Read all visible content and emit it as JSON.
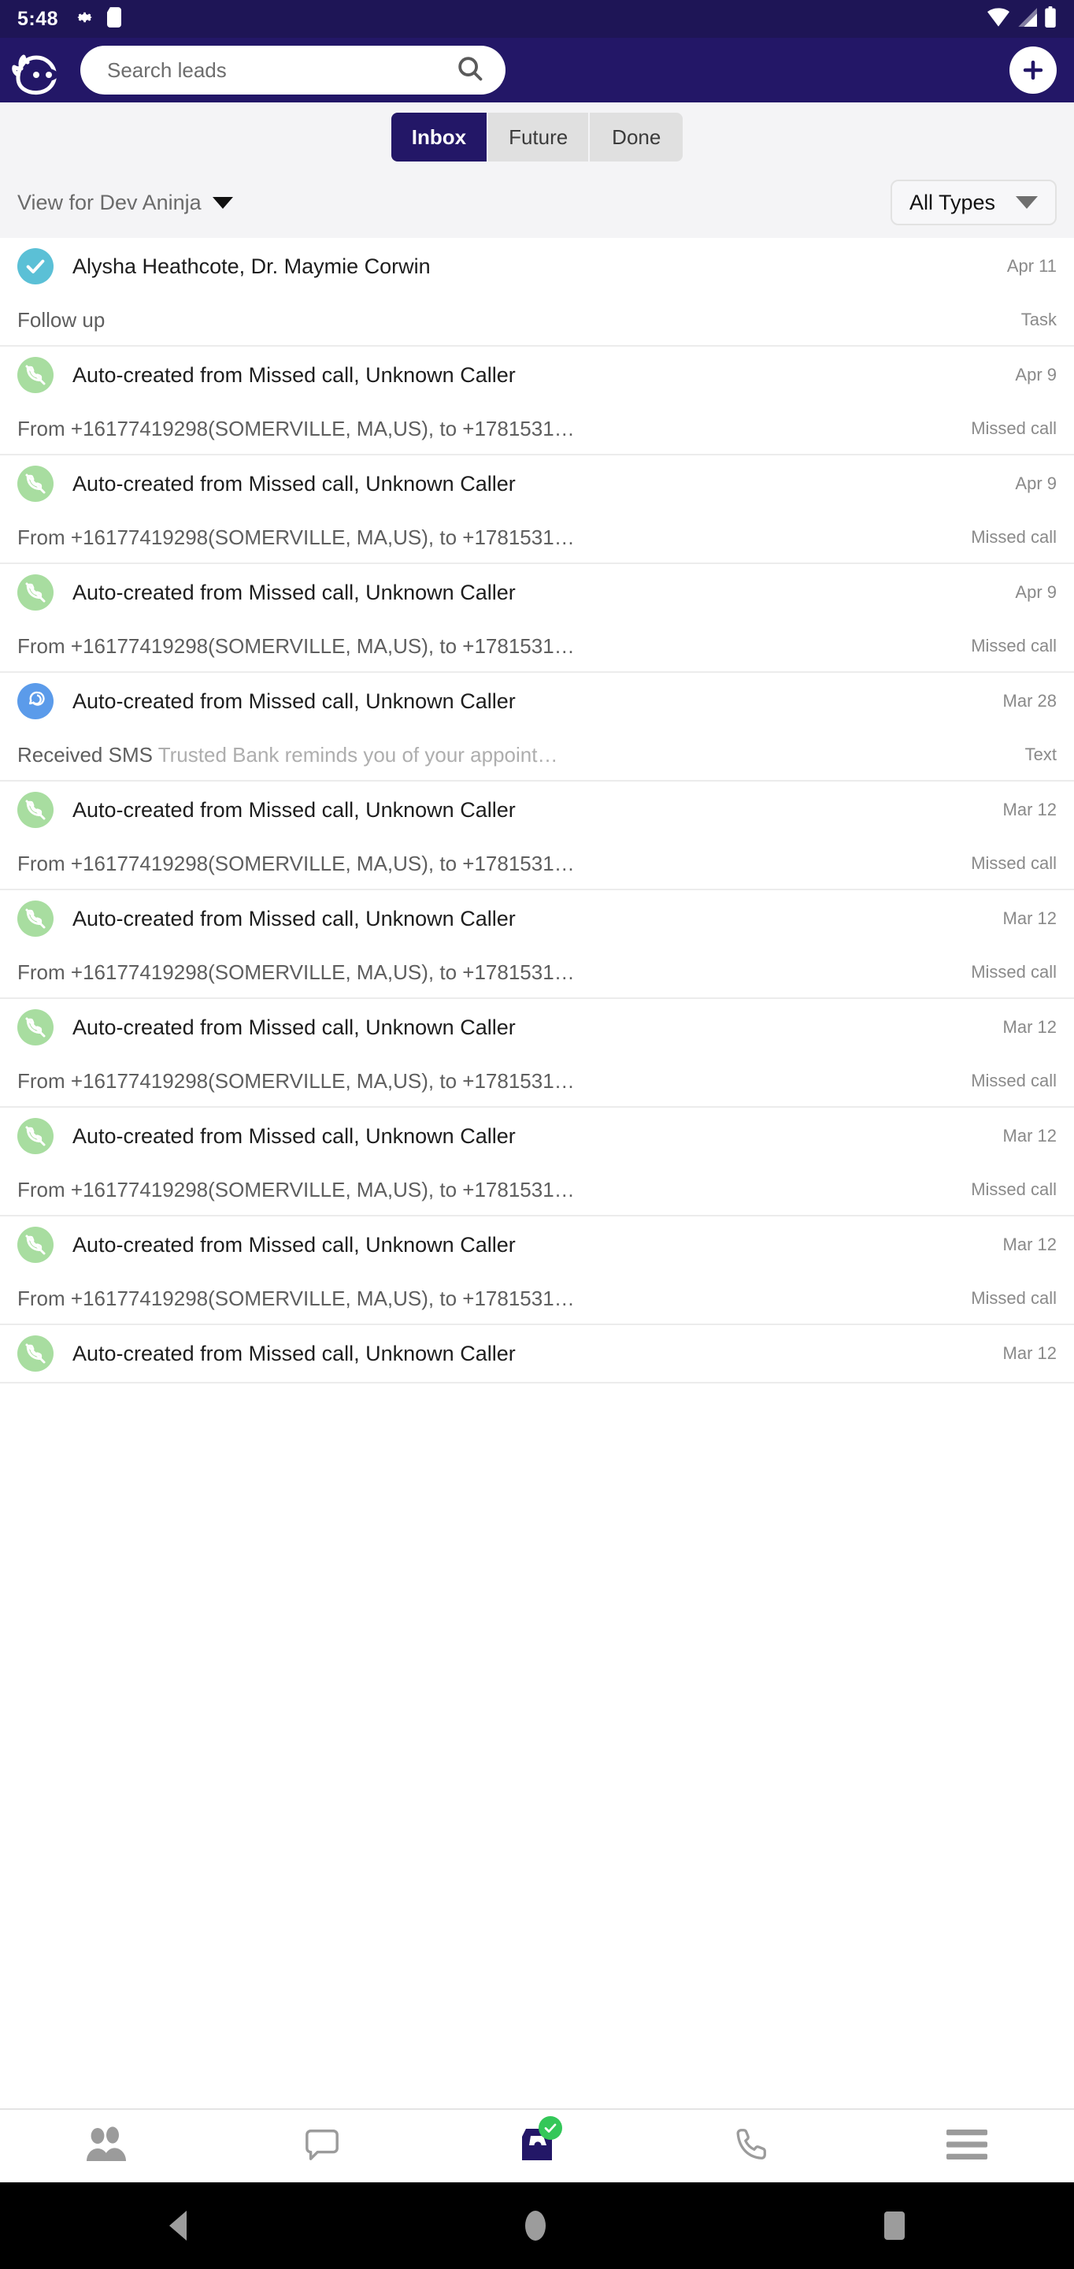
{
  "status_bar": {
    "time": "5:48",
    "left_icons": [
      "gear-icon",
      "sd-card-icon"
    ],
    "right_icons": [
      "wifi-icon",
      "signal-icon",
      "battery-icon"
    ]
  },
  "app_bar": {
    "logo": "ninja-logo",
    "search_placeholder": "Search leads",
    "search_value": "",
    "search_icon": "search-icon",
    "add_button": "+"
  },
  "tabs": [
    {
      "label": "Inbox",
      "active": true
    },
    {
      "label": "Future",
      "active": false
    },
    {
      "label": "Done",
      "active": false
    }
  ],
  "filter_bar": {
    "view_for": "View for Dev Aninja",
    "types_selected": "All Types"
  },
  "colors": {
    "header": "#231767",
    "status_bar": "#1e1556",
    "accent": "#231767",
    "task_avatar": "#5bc0d6",
    "call_avatar": "#a8dda0",
    "text_avatar": "#5b9bea",
    "badge_green": "#34c759",
    "page_bg": "#f4f4f6"
  },
  "list": [
    {
      "icon": "check-circle-icon",
      "icon_kind": "task",
      "title": "Alysha Heathcote, Dr. Maymie Corwin",
      "date": "Apr 11",
      "subtitle_dark": "Follow up",
      "subtitle_light": "",
      "badge": "Task"
    },
    {
      "icon": "missed-call-icon",
      "icon_kind": "call",
      "title": "Auto-created from Missed call, Unknown Caller",
      "date": "Apr 9",
      "subtitle_dark": "From +16177419298(SOMERVILLE, MA,US), to +1781531…",
      "subtitle_light": "",
      "badge": "Missed call"
    },
    {
      "icon": "missed-call-icon",
      "icon_kind": "call",
      "title": "Auto-created from Missed call, Unknown Caller",
      "date": "Apr 9",
      "subtitle_dark": "From +16177419298(SOMERVILLE, MA,US), to +1781531…",
      "subtitle_light": "",
      "badge": "Missed call"
    },
    {
      "icon": "missed-call-icon",
      "icon_kind": "call",
      "title": "Auto-created from Missed call, Unknown Caller",
      "date": "Apr 9",
      "subtitle_dark": "From +16177419298(SOMERVILLE, MA,US), to +1781531…",
      "subtitle_light": "",
      "badge": "Missed call"
    },
    {
      "icon": "chat-bubbles-icon",
      "icon_kind": "text",
      "title": "Auto-created from Missed call, Unknown Caller",
      "date": "Mar 28",
      "subtitle_dark": "Received SMS",
      "subtitle_light": "Trusted Bank reminds you of your appoint…",
      "badge": "Text"
    },
    {
      "icon": "missed-call-icon",
      "icon_kind": "call",
      "title": "Auto-created from Missed call, Unknown Caller",
      "date": "Mar 12",
      "subtitle_dark": "From +16177419298(SOMERVILLE, MA,US), to +1781531…",
      "subtitle_light": "",
      "badge": "Missed call"
    },
    {
      "icon": "missed-call-icon",
      "icon_kind": "call",
      "title": "Auto-created from Missed call, Unknown Caller",
      "date": "Mar 12",
      "subtitle_dark": "From +16177419298(SOMERVILLE, MA,US), to +1781531…",
      "subtitle_light": "",
      "badge": "Missed call"
    },
    {
      "icon": "missed-call-icon",
      "icon_kind": "call",
      "title": "Auto-created from Missed call, Unknown Caller",
      "date": "Mar 12",
      "subtitle_dark": "From +16177419298(SOMERVILLE, MA,US), to +1781531…",
      "subtitle_light": "",
      "badge": "Missed call"
    },
    {
      "icon": "missed-call-icon",
      "icon_kind": "call",
      "title": "Auto-created from Missed call, Unknown Caller",
      "date": "Mar 12",
      "subtitle_dark": "From +16177419298(SOMERVILLE, MA,US), to +1781531…",
      "subtitle_light": "",
      "badge": "Missed call"
    },
    {
      "icon": "missed-call-icon",
      "icon_kind": "call",
      "title": "Auto-created from Missed call, Unknown Caller",
      "date": "Mar 12",
      "subtitle_dark": "From +16177419298(SOMERVILLE, MA,US), to +1781531…",
      "subtitle_light": "",
      "badge": "Missed call"
    },
    {
      "icon": "missed-call-icon",
      "icon_kind": "call",
      "title": "Auto-created from Missed call, Unknown Caller",
      "date": "Mar 12",
      "subtitle_dark": "",
      "subtitle_light": "",
      "badge": ""
    }
  ],
  "bottom_nav": [
    {
      "icon": "contacts-icon",
      "active": false
    },
    {
      "icon": "message-bubble-icon",
      "active": false
    },
    {
      "icon": "inbox-icon",
      "active": true,
      "badge": "check-badge"
    },
    {
      "icon": "phone-icon",
      "active": false
    },
    {
      "icon": "hamburger-menu-icon",
      "active": false
    }
  ],
  "android_nav": [
    {
      "icon": "back-icon"
    },
    {
      "icon": "home-icon"
    },
    {
      "icon": "recents-icon"
    }
  ]
}
